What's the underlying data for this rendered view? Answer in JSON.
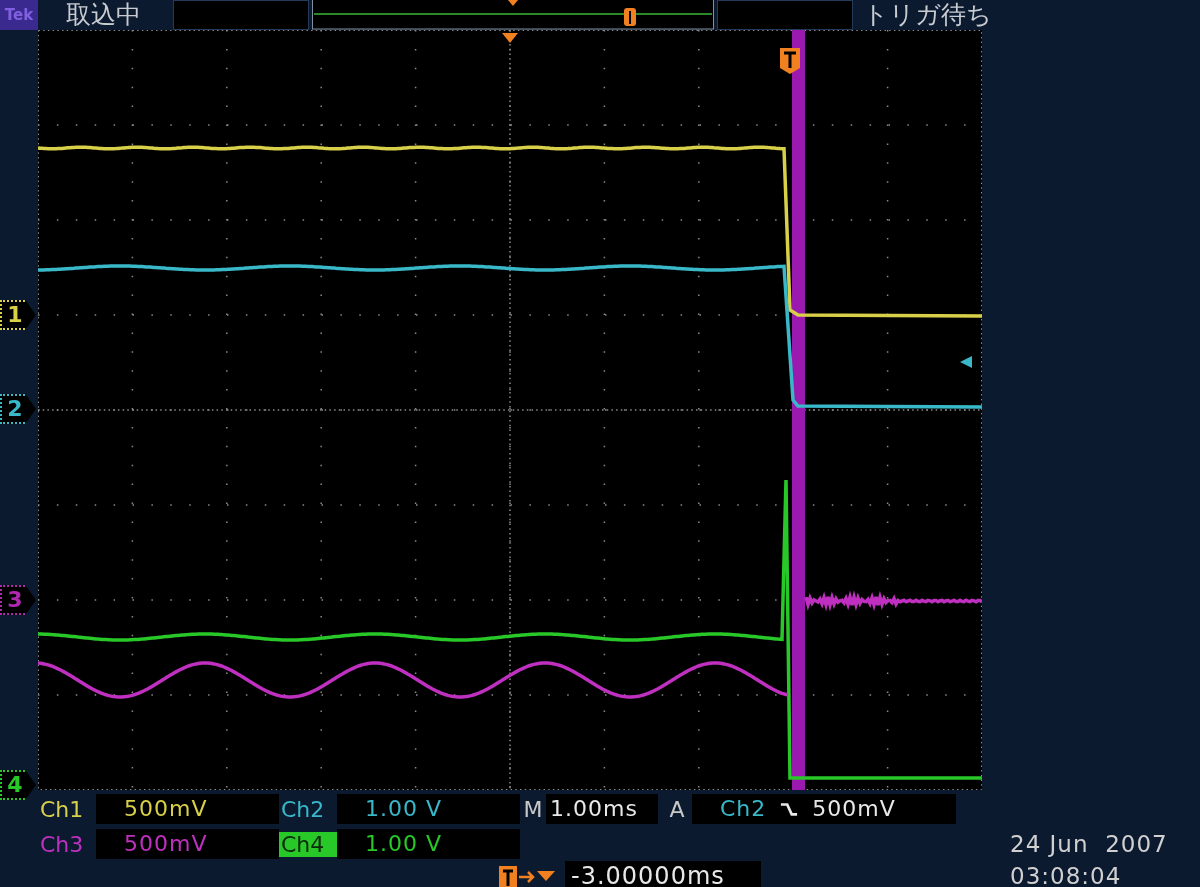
{
  "top_bar": {
    "logo": "Tek",
    "acquisition": "取込中",
    "trigger_status": "トリガ待ち"
  },
  "channel_markers": [
    {
      "label": "1",
      "color": "#d8d048"
    },
    {
      "label": "2",
      "color": "#38b8c8"
    },
    {
      "label": "3",
      "color": "#b028b0"
    },
    {
      "label": "4",
      "color": "#28c828"
    }
  ],
  "readouts": [
    {
      "channel": "Ch1",
      "scale": "500mV",
      "color": "#d8d048",
      "inverted": false
    },
    {
      "channel": "Ch2",
      "scale": "1.00 V",
      "color": "#38b8c8",
      "inverted": false
    },
    {
      "channel": "Ch3",
      "scale": "500mV",
      "color": "#c030c0",
      "inverted": false
    },
    {
      "channel": "Ch4",
      "scale": "1.00 V",
      "color": "#28c828",
      "inverted": true
    }
  ],
  "timebase": {
    "prefix": "M",
    "value": "1.00ms"
  },
  "trigger": {
    "mode": "A",
    "source": "Ch2",
    "level": "500mV"
  },
  "position": {
    "value": "-3.00000ms"
  },
  "date": "24 Jun  2007",
  "time": "03:08:04"
}
